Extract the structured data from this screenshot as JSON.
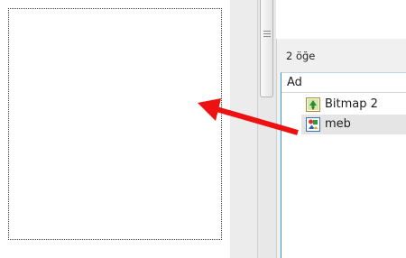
{
  "explorer": {
    "item_count": "2 öğe",
    "column_name": "Ad",
    "files": [
      {
        "name": "Bitmap 2",
        "icon": "bitmap-image-icon",
        "selected": false
      },
      {
        "name": "meb",
        "icon": "image-file-icon",
        "selected": true
      }
    ]
  },
  "colors": {
    "arrow": "#ee1111",
    "selection": "#e5e5e5",
    "panel_border": "#3399dd"
  }
}
